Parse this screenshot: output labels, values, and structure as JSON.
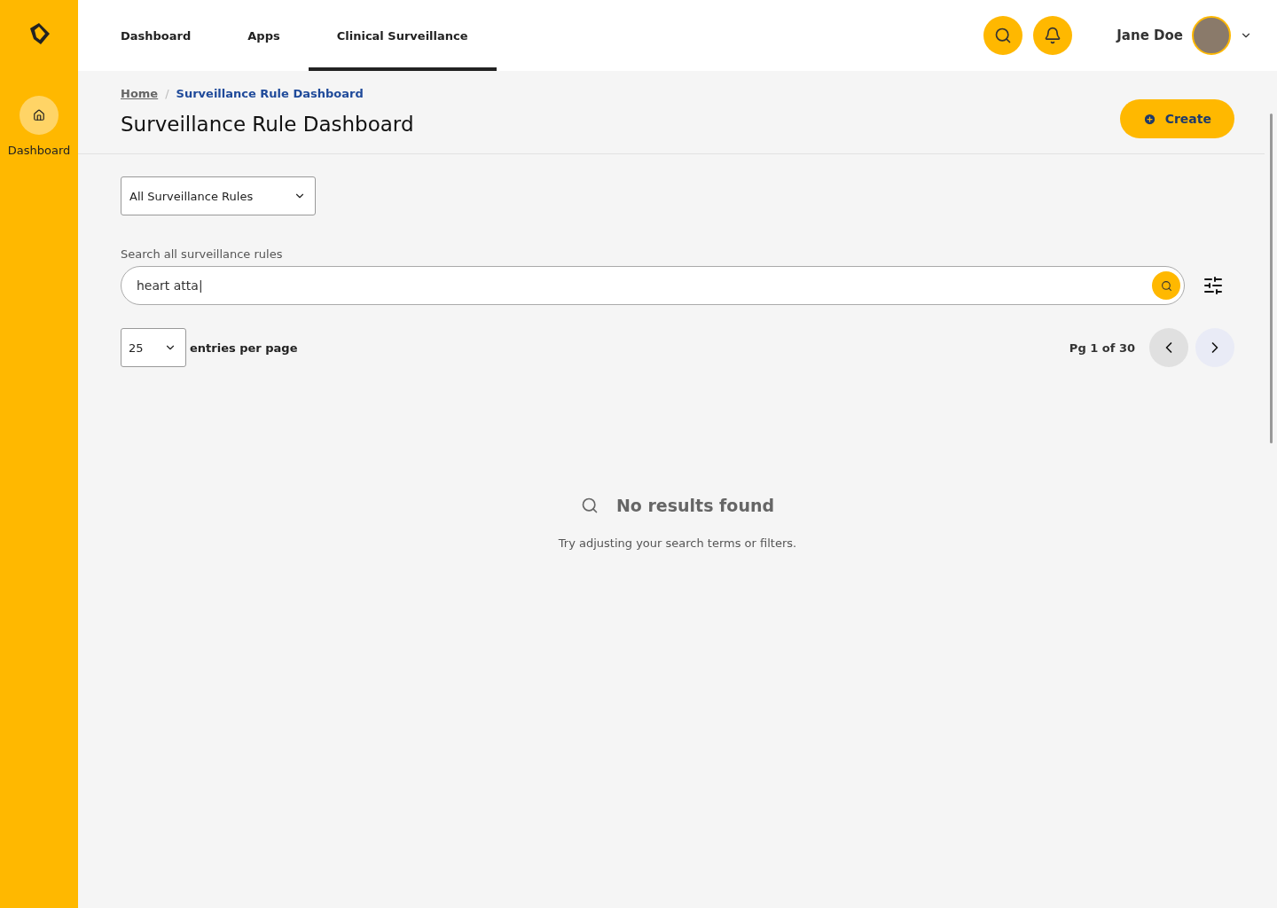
{
  "sidebar": {
    "items": [
      {
        "label": "Dashboard",
        "selected": true
      }
    ]
  },
  "nav": {
    "tabs": [
      {
        "label": "Dashboard",
        "selected": false
      },
      {
        "label": "Apps",
        "selected": false
      },
      {
        "label": "Clinical Surveillance",
        "selected": true
      }
    ]
  },
  "user": {
    "name": "Jane Doe"
  },
  "breadcrumb_separator": "/",
  "breadcrumbs": [
    {
      "label": "Home",
      "current": false
    },
    {
      "label": "Surveillance Rule Dashboard",
      "current": true
    }
  ],
  "page_title": "Surveillance Rule Dashboard",
  "create_button": "Create",
  "rule_filter": {
    "value": "All Surveillance Rules"
  },
  "search": {
    "label": "Search all surveillance rules",
    "value": "heart atta|"
  },
  "page_size": {
    "value": "25",
    "label": "entries per page"
  },
  "pagination": {
    "text": "Pg 1 of 30",
    "previous_disabled": true,
    "next_disabled": false
  },
  "empty_state": {
    "title": "No results found",
    "message": "Try adjusting your search terms or filters."
  }
}
